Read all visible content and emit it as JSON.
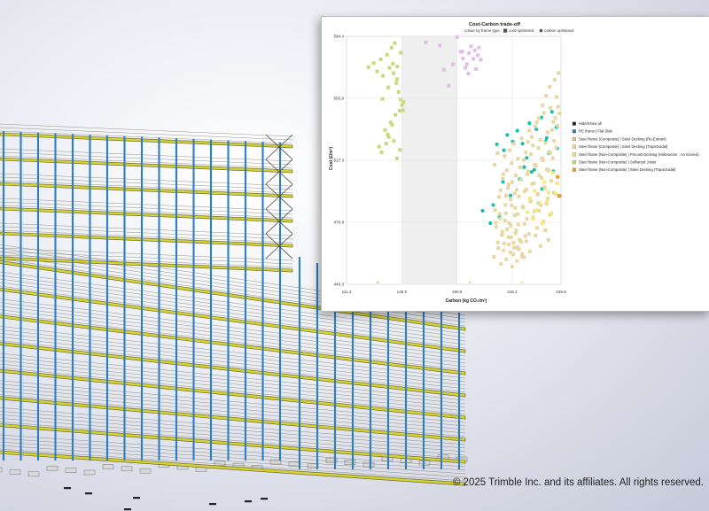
{
  "copyright": "© 2025 Trimble Inc. and its affiliates. All rights reserved.",
  "chart_data": {
    "type": "scatter",
    "title": "Cost-Carbon trade-off",
    "subtitle_prefix": "colour by frame type ;",
    "subtitle_markers": [
      {
        "label": "cost-optimised",
        "shape": "square"
      },
      {
        "label": "carbon optimised",
        "shape": "circle"
      }
    ],
    "xlabel": "Carbon (kg CO₂/m²)",
    "ylabel": "Cost (£/m²)",
    "xlim": [
      111.3,
      245.8
    ],
    "ylim": [
      440.3,
      594.4
    ],
    "xticks": [
      "111.3",
      "146.0",
      "180.6",
      "215.2",
      "245.8"
    ],
    "yticks": [
      "594.4",
      "555.9",
      "517.3",
      "478.8",
      "440.3"
    ],
    "shaded_band": [
      146.0,
      180.6
    ],
    "legend_position": "right",
    "legend": [
      {
        "label": "Hide/Show all",
        "color": "#1f1f1f"
      },
      {
        "label": "RC frame | Flat Slab",
        "color": "#2a7ab0"
      },
      {
        "label": "Steel frame (Composite) | Steel Decking (Re-Entrant)",
        "color": "#d9c58f"
      },
      {
        "label": "Steel frame (Composite) | Steel Decking (Trapezoidal)",
        "color": "#ead9a3"
      },
      {
        "label": "Steel frame (Non-Composite) | Precast Decking (Hollowcore ; no Screed)",
        "color": "#f2e47a"
      },
      {
        "label": "Steel frame (Non-Composite) | Softwood Joists",
        "color": "#c9d98a"
      },
      {
        "label": "Steel frame (Non-Composite) | Steel Decking (Trapezoidal)",
        "color": "#f0a04a"
      }
    ],
    "series": [
      {
        "name": "Steel frame (Non-Composite) | Softwood Joists",
        "color": "#c7da7d",
        "x": [
          125.1,
          128.3,
          130.5,
          132.8,
          134.1,
          136.7,
          138.2,
          139.5,
          140.8,
          141.6,
          142.5,
          143.1,
          143.9,
          144.6,
          145.2,
          146.1,
          147.0,
          142.0,
          139.9,
          137.8,
          136.2,
          135.4,
          133.3,
          131.7,
          137.1,
          139.0,
          141.0,
          143.0,
          144.8,
          146.6,
          137.5,
          140.4,
          142.9,
          145.3,
          133.8
        ],
        "y": [
          575.2,
          577.8,
          572.6,
          580.1,
          569.9,
          583.0,
          574.8,
          587.3,
          571.5,
          590.2,
          565.4,
          575.6,
          559.8,
          548.2,
          555.1,
          551.7,
          553.6,
          545.6,
          539.4,
          531.8,
          527.7,
          536.2,
          522.3,
          525.8,
          533.4,
          540.9,
          529.5,
          518.6,
          523.9,
          548.4,
          562.7,
          577.4,
          567.8,
          584.2,
          555.4
        ]
      },
      {
        "name": "Steel frame (Composite) | Steel Decking (Re-Entrant)",
        "color": "#e3bde7",
        "x": [
          180.7,
          182.9,
          184.3,
          186.8,
          188.1,
          189.4,
          190.9,
          191.7,
          192.5,
          193.6,
          194.3,
          195.5,
          185.8,
          187.7,
          161.0,
          169.8,
          172.3,
          175.4,
          178.0,
          183.8
        ],
        "y": [
          594.0,
          584.8,
          580.6,
          577.1,
          583.9,
          588.2,
          580.4,
          585.7,
          574.0,
          582.6,
          587.4,
          579.9,
          574.9,
          571.2,
          590.6,
          588.8,
          573.7,
          563.6,
          577.0,
          585.0
        ]
      },
      {
        "name": "RC frame | Flat Slab",
        "color": "#19bfa6",
        "x": [
          205.6,
          212.1,
          218.4,
          221.7,
          226.0,
          230.3,
          233.5,
          236.8,
          240.1,
          242.9,
          210.0,
          215.5,
          224.3,
          229.0,
          238.2,
          243.5,
          209.4,
          219.9,
          227.3,
          234.0,
          241.0,
          245.0,
          214.1,
          222.7,
          231.8,
          196.6,
          203.3,
          201.5,
          207.2,
          236.2
        ],
        "y": [
          527.3,
          533.1,
          535.8,
          527.7,
          540.4,
          536.7,
          544.0,
          531.2,
          547.5,
          538.0,
          523.6,
          529.0,
          518.9,
          511.4,
          521.7,
          524.8,
          503.9,
          505.7,
          510.1,
          499.6,
          510.5,
          495.2,
          495.5,
          513.1,
          490.8,
          486.0,
          489.6,
          478.3,
          482.0,
          529.2
        ]
      },
      {
        "name": "Steel frame (Composite) | Steel Decking (Trapezoidal)",
        "color": "#e7d7a3",
        "x": [
          210.4,
          213.6,
          216.2,
          218.8,
          221.1,
          223.7,
          225.9,
          228.2,
          230.6,
          232.8,
          235.0,
          237.3,
          239.2,
          241.0,
          243.1,
          244.8,
          211.8,
          214.9,
          217.5,
          220.2,
          222.4,
          224.6,
          227.0,
          229.4,
          231.6,
          233.9,
          236.1,
          238.4,
          240.2,
          242.2,
          244.0,
          209.3,
          212.5,
          215.3,
          218.0,
          220.6,
          223.0,
          225.3,
          227.7,
          230.0,
          232.3,
          234.5,
          236.9,
          239.0,
          241.5,
          243.6,
          206.9,
          210.9,
          214.2,
          217.1,
          219.4,
          221.9,
          224.1,
          226.5,
          228.9,
          231.2,
          233.6,
          235.7,
          238.0,
          240.6,
          242.8,
          204.5,
          207.6,
          211.2,
          213.3,
          216.8,
          219.0,
          222.2,
          224.4,
          226.8,
          229.1,
          231.3,
          233.2,
          235.4,
          237.6,
          239.8,
          205.3,
          208.7,
          212.0,
          214.6,
          217.7,
          220.1,
          222.9,
          225.7,
          228.3,
          230.8,
          232.1,
          234.8,
          236.7,
          238.9,
          241.3,
          206.2,
          209.8,
          213.1,
          215.8,
          218.5,
          221.4,
          224.0,
          226.3,
          229.8,
          233.0,
          235.9,
          237.9,
          203.8,
          206.5,
          208.2,
          210.1,
          211.5,
          213.9,
          215.1,
          216.5,
          218.2,
          219.8,
          221.5,
          223.4,
          205.0,
          207.3,
          209.0,
          210.7,
          212.8,
          214.4,
          216.0,
          217.3,
          219.3,
          220.8,
          222.6,
          204.2,
          206.0,
          207.9,
          209.6,
          211.4,
          213.0,
          214.8,
          216.7,
          218.6,
          225.1,
          227.4,
          229.6,
          231.9,
          234.2,
          236.5,
          238.7,
          241.8,
          244.3
        ],
        "y": [
          519.9,
          523.6,
          527.7,
          518.3,
          531.0,
          522.2,
          535.8,
          526.6,
          540.9,
          530.1,
          546.8,
          534.7,
          550.0,
          541.3,
          556.7,
          546.5,
          511.2,
          515.5,
          508.0,
          512.9,
          517.6,
          508.7,
          521.1,
          514.6,
          525.0,
          518.6,
          528.2,
          522.5,
          536.2,
          543.8,
          550.6,
          505.9,
          500.2,
          503.8,
          499.0,
          505.3,
          498.1,
          510.4,
          502.7,
          513.9,
          507.9,
          517.3,
          511.7,
          521.9,
          529.4,
          538.9,
          494.6,
          489.6,
          493.1,
          487.8,
          494.8,
          488.6,
          499.2,
          491.8,
          503.1,
          496.4,
          506.4,
          499.9,
          510.9,
          518.7,
          525.3,
          486.4,
          481.2,
          484.4,
          478.3,
          483.2,
          477.5,
          487.9,
          480.9,
          492.2,
          485.7,
          496.1,
          489.4,
          500.6,
          493.6,
          504.5,
          475.9,
          470.9,
          474.5,
          469.5,
          473.9,
          467.8,
          477.8,
          471.7,
          481.8,
          475.3,
          486.0,
          479.5,
          490.2,
          483.5,
          497.2,
          466.3,
          461.4,
          465.0,
          458.9,
          463.3,
          457.4,
          467.0,
          460.7,
          470.6,
          464.1,
          473.9,
          467.8,
          457.3,
          462.7,
          452.9,
          465.6,
          455.8,
          460.2,
          451.3,
          463.0,
          454.8,
          468.0,
          459.2,
          470.3,
          478.6,
          484.0,
          473.0,
          479.8,
          469.7,
          476.6,
          466.0,
          472.0,
          462.0,
          466.8,
          457.0,
          514.7,
          521.8,
          498.8,
          508.8,
          495.3,
          502.4,
          489.3,
          496.7,
          483.9,
          528.8,
          531.9,
          538.4,
          543.5,
          551.5,
          557.5,
          563.0,
          567.4,
          571.6
        ]
      },
      {
        "name": "Steel frame (Non-Composite) | Precast Decking (Hollowcore ; no Screed)",
        "color": "#f5e87c",
        "x": [
          226.2,
          229.3,
          232.1,
          235.4,
          238.0,
          240.7,
          243.4,
          224.8,
          230.5,
          234.0,
          237.1,
          239.8,
          242.5,
          228.0
        ],
        "y": [
          493.6,
          498.5,
          491.0,
          503.8,
          497.3,
          509.6,
          503.1,
          485.2,
          486.4,
          478.2,
          492.0,
          484.4,
          496.6,
          481.0
        ]
      },
      {
        "name": "Steel frame (Non-Composite) | Steel Decking (Trapezoidal)",
        "color": "#f39a3a",
        "x": [
          244.6,
          243.7
        ],
        "y": [
          495.3,
          507.0
        ]
      }
    ],
    "axis_markers": [
      {
        "x": 130.8,
        "color": "#c7da7d"
      },
      {
        "x": 188.6,
        "color": "#e7d7a3"
      },
      {
        "x": 221.4,
        "color": "#f5e87c"
      }
    ]
  }
}
